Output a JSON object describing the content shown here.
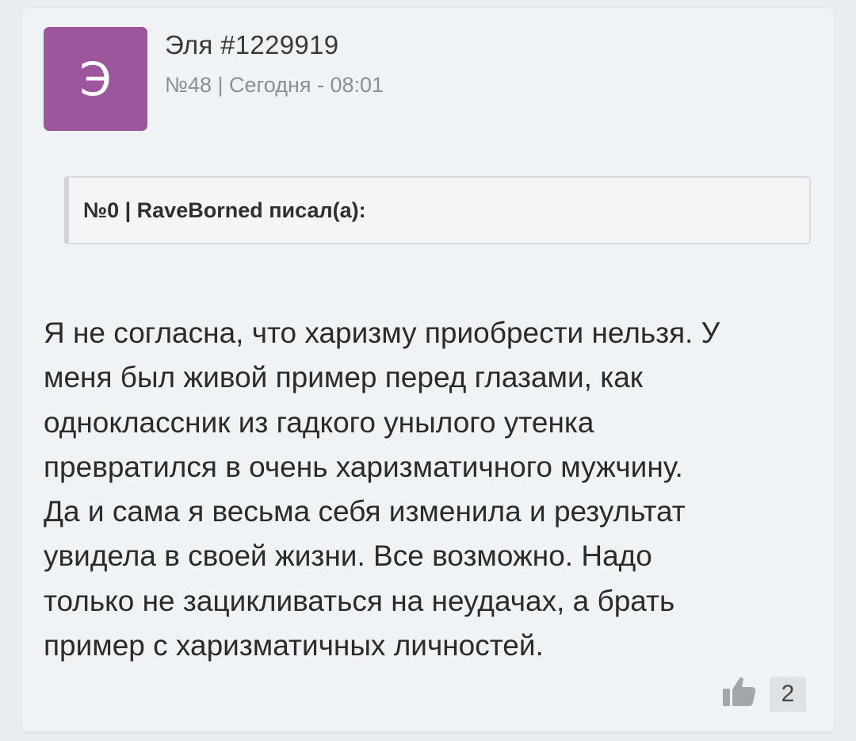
{
  "post": {
    "avatar_letter": "Э",
    "avatar_color": "#9b569c",
    "username": "Эля #1229919",
    "meta": "№48 | Сегодня - 08:01",
    "quote": {
      "header": "№0 | RaveBorned писал(а):"
    },
    "body_lines": [
      "Я не согласна, что харизму приобрести нельзя. У",
      "меня был живой пример перед глазами, как",
      "одноклассник из гадкого унылого утенка",
      "превратился в очень харизматичного мужчину.",
      "Да и сама я весьма себя изменила и результат",
      "увидела в своей жизни. Все возможно. Надо",
      "только не зацикливаться на неудачах, а брать",
      "пример с харизматичных личностей."
    ],
    "like": {
      "icon": "thumbs-up-icon",
      "count": "2"
    }
  }
}
